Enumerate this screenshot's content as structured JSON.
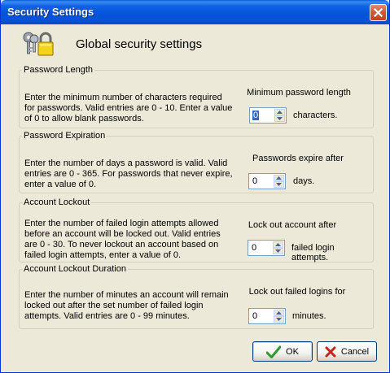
{
  "window": {
    "title": "Security Settings"
  },
  "header": {
    "title": "Global security settings",
    "icon": "keys-and-padlock-icon"
  },
  "groups": {
    "password_length": {
      "legend": "Password Length",
      "desc": "Enter the minimum number of characters required for passwords.  Valid entries are 0 - 10.  Enter a value of 0 to allow blank passwords.",
      "label": "Minimum password length",
      "value": "0",
      "unit": "characters."
    },
    "password_expiration": {
      "legend": "Password Expiration",
      "desc": "Enter the number of days a password is valid.  Valid entries are 0 - 365.  For passwords that never expire, enter a value of 0.",
      "label": "Passwords expire after",
      "value": "0",
      "unit": "days."
    },
    "account_lockout": {
      "legend": "Account Lockout",
      "desc": "Enter the number of failed login attempts allowed before an account will be locked out.  Valid entries are 0 - 30.  To never lockout an account based on failed login attempts, enter a value of 0.",
      "label": "Lock out account after",
      "value": "0",
      "unit": "failed login attempts."
    },
    "lockout_duration": {
      "legend": "Account Lockout Duration",
      "desc": "Enter the number of minutes an account will remain locked out after the set number of failed login attempts.  Valid entries are 0 - 99 minutes.",
      "label": "Lock out failed logins for",
      "value": "0",
      "unit": "minutes."
    }
  },
  "buttons": {
    "ok": "OK",
    "cancel": "Cancel"
  },
  "colors": {
    "accent": "#0554d8",
    "ok_check": "#2e9b2e",
    "cancel_x": "#c0281c"
  }
}
